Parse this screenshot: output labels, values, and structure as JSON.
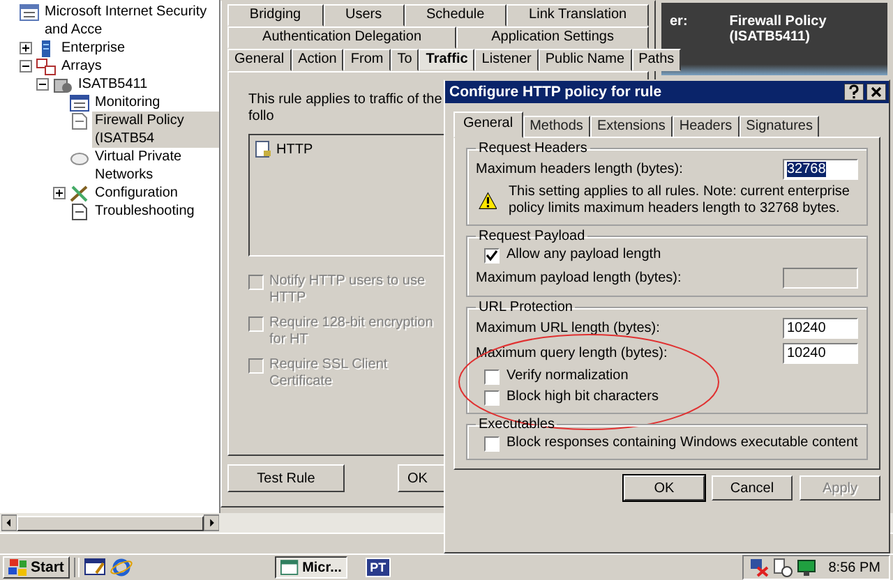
{
  "console": {
    "tree": [
      {
        "label": "Microsoft Internet Security and Acce",
        "kind": "console",
        "selected": false,
        "children": [
          {
            "label": "Enterprise",
            "kind": "enterprise",
            "expanded": false,
            "selected": false
          },
          {
            "label": "Arrays",
            "kind": "arrays",
            "expanded": true,
            "selected": false,
            "children": [
              {
                "label": "ISATB5411",
                "kind": "server",
                "expanded": true,
                "selected": false,
                "children": [
                  {
                    "label": "Monitoring",
                    "kind": "monitoring",
                    "selected": false
                  },
                  {
                    "label": "Firewall Policy (ISATB54",
                    "kind": "policy",
                    "selected": true
                  },
                  {
                    "label": "Virtual Private Networks",
                    "kind": "vpn",
                    "selected": false
                  },
                  {
                    "label": "Configuration",
                    "kind": "configuration",
                    "expanded": false,
                    "selected": false
                  },
                  {
                    "label": "Troubleshooting",
                    "kind": "troubleshooting",
                    "selected": false
                  }
                ]
              }
            ]
          }
        ]
      }
    ],
    "header": {
      "label": "er:",
      "value": "Firewall Policy (ISATB5411)"
    }
  },
  "rule_dialog": {
    "tab_rows": [
      [
        {
          "label": "Bridging",
          "selected": false
        },
        {
          "label": "Users",
          "selected": false
        },
        {
          "label": "Schedule",
          "selected": false
        },
        {
          "label": "Link Translation",
          "selected": false
        }
      ],
      [
        {
          "label": "Authentication Delegation",
          "selected": false
        },
        {
          "label": "Application Settings",
          "selected": false
        }
      ],
      [
        {
          "label": "General",
          "selected": false
        },
        {
          "label": "Action",
          "selected": false
        },
        {
          "label": "From",
          "selected": false
        },
        {
          "label": "To",
          "selected": false
        },
        {
          "label": "Traffic",
          "selected": true
        },
        {
          "label": "Listener",
          "selected": false
        },
        {
          "label": "Public Name",
          "selected": false
        },
        {
          "label": "Paths",
          "selected": false
        }
      ]
    ],
    "intro": "This rule applies to traffic of the follo",
    "protocols": [
      {
        "label": "HTTP",
        "selected": false
      }
    ],
    "options": [
      {
        "label": "Notify HTTP users to use HTTP",
        "checked": false,
        "disabled": true
      },
      {
        "label": "Require 128-bit encryption for HT",
        "checked": false,
        "disabled": true
      },
      {
        "label": "Require SSL Client Certificate",
        "checked": false,
        "disabled": true
      }
    ],
    "buttons": [
      {
        "label": "Test Rule"
      },
      {
        "label": "OK"
      }
    ]
  },
  "http_dialog": {
    "title": "Configure HTTP policy for rule",
    "tabs": [
      {
        "label": "General",
        "selected": true
      },
      {
        "label": "Methods",
        "selected": false
      },
      {
        "label": "Extensions",
        "selected": false
      },
      {
        "label": "Headers",
        "selected": false
      },
      {
        "label": "Signatures",
        "selected": false
      }
    ],
    "groups": [
      {
        "title": "Request Headers",
        "annotated": false,
        "rows": [
          {
            "kind": "number",
            "label": "Maximum headers length (bytes):",
            "value": "32768",
            "selected": true,
            "disabled": false
          },
          {
            "kind": "warning",
            "text": "This setting applies to all rules. Note: current enterprise policy limits maximum headers length to 32768 bytes."
          }
        ]
      },
      {
        "title": "Request Payload",
        "annotated": false,
        "rows": [
          {
            "kind": "checkbox",
            "label": "Allow any payload length",
            "checked": true
          },
          {
            "kind": "number",
            "label": "Maximum payload length (bytes):",
            "disabled": true
          }
        ]
      },
      {
        "title": "URL Protection",
        "annotated": true,
        "rows": [
          {
            "kind": "number",
            "label": "Maximum URL length (bytes):",
            "value": "10240",
            "selected": false,
            "disabled": false
          },
          {
            "kind": "number",
            "label": "Maximum query length (bytes):",
            "value": "10240",
            "selected": false,
            "disabled": false
          },
          {
            "kind": "checkbox",
            "label": "Verify normalization",
            "checked": false
          },
          {
            "kind": "checkbox",
            "label": "Block high bit characters",
            "checked": false
          }
        ]
      },
      {
        "title": "Executables",
        "annotated": false,
        "rows": [
          {
            "kind": "checkbox",
            "label": "Block responses containing Windows executable content",
            "checked": false
          }
        ]
      }
    ],
    "buttons": [
      {
        "label": "OK",
        "default": true,
        "disabled": false
      },
      {
        "label": "Cancel",
        "default": false,
        "disabled": false
      },
      {
        "label": "Apply",
        "default": false,
        "disabled": true
      }
    ]
  },
  "taskbar": {
    "start": "Start",
    "tasks": [
      {
        "kind": "window",
        "label": "Micr...",
        "selected": true
      },
      {
        "kind": "app",
        "label": "PT",
        "selected": false
      }
    ],
    "clock": "8:56 PM"
  }
}
